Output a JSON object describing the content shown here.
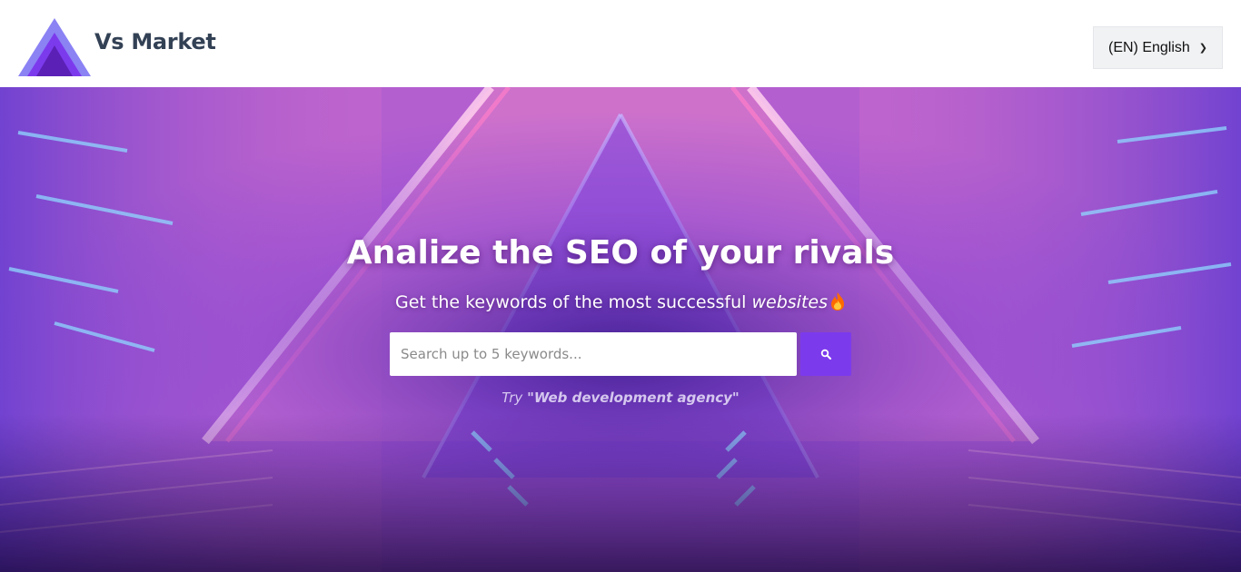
{
  "header": {
    "brand": "Vs Market",
    "logo_icon": "triangle-logo-icon",
    "language_select": {
      "value": "(EN) English",
      "icon": "chevron-down-icon"
    }
  },
  "hero": {
    "title": "Analize the SEO of your rivals",
    "subtitle_text": "Get the keywords of the most successful ",
    "subtitle_em": "websites",
    "subtitle_icon": "fire-emoji-icon",
    "search": {
      "placeholder": "Search up to 5 keywords...",
      "value": "",
      "button_icon": "search-icon"
    },
    "try_label": "Try",
    "try_suggestion": "\"Web development agency\""
  },
  "colors": {
    "accent": "#7c3aed",
    "brand_text": "#334155",
    "logo_outer": "#8b82f4",
    "logo_mid": "#7c3aed",
    "logo_inner": "#5b21b6"
  }
}
